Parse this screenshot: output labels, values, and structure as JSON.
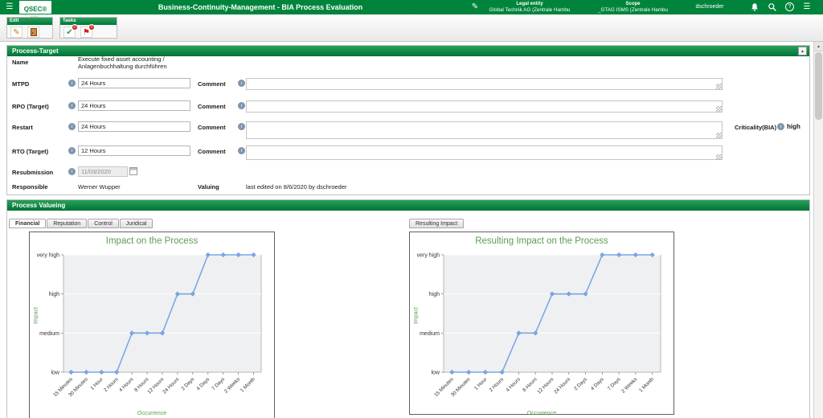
{
  "colors": {
    "topbar_green": "#00843c",
    "header_grad_top": "#2ca05a",
    "header_grad_bottom": "#00783a",
    "title_green": "#5b9e52",
    "badge_red": "#d21414",
    "chart_line": "#7da7e8"
  },
  "icons": {
    "menu": "☰",
    "pencil": "✎",
    "check": "✔",
    "flag": "⚑",
    "collapse_up": "▲",
    "scroll_up": "▲",
    "question": "?",
    "info": "i"
  },
  "top_bar": {
    "logo_text": "QSEC®",
    "logo_sub": "GRC",
    "title": "Business-Continuity-Management - BIA Process Evaluation",
    "legal_entity": {
      "label": "Legal entity",
      "value": "Global Technik AG (Zentrale Hambu"
    },
    "scope": {
      "label": "Scope",
      "value": "_GTAG ISMS (Zentrale Hambu"
    },
    "user": "dschroeder"
  },
  "toolbar": {
    "edit": {
      "label": "Edit"
    },
    "tasks": {
      "label": "Tasks",
      "badge1": "0",
      "badge2": "0"
    }
  },
  "process_target": {
    "title": "Process-Target",
    "comment_label": "Comment",
    "name": {
      "label": "Name",
      "line1": "Execute fixed asset accounting /",
      "line2": "Anlagenbuchhaltung durchführen"
    },
    "mtpd": {
      "label": "MTPD",
      "value": "24 Hours"
    },
    "rpo": {
      "label": "RPO (Target)",
      "value": "24 Hours"
    },
    "restart": {
      "label": "Restart",
      "value": "24 Hours"
    },
    "rto": {
      "label": "RTO (Target)",
      "value": "12 Hours"
    },
    "criticality": {
      "label": "Criticality(BIA)",
      "value": "high"
    },
    "resubmission": {
      "label": "Resubmission",
      "value": "11/03/2020"
    },
    "responsible": {
      "label": "Responsible",
      "value": "Werner Wupper"
    },
    "valuing": {
      "label": "Valuing",
      "value": "last edited on 8/6/2020 by dschroeder"
    }
  },
  "process_valueing": {
    "title": "Process Valueing",
    "tabs": [
      "Financial",
      "Reputation",
      "Control",
      "Juridical"
    ],
    "right_tab": "Resulting Impact"
  },
  "chart_data": [
    {
      "type": "line",
      "title": "Impact on the Process",
      "xlabel": "Occurrence",
      "ylabel": "Impact",
      "categories": [
        "15 Minutes",
        "30 Minutes",
        "1 Hour",
        "2 Hours",
        "4 Hours",
        "8 Hours",
        "12 Hours",
        "24 Hours",
        "2 Days",
        "4 Days",
        "7 Days",
        "2 Weeks",
        "1 Month"
      ],
      "y_categories": [
        "low",
        "medium",
        "high",
        "very high"
      ],
      "values": [
        "low",
        "low",
        "low",
        "low",
        "medium",
        "medium",
        "medium",
        "high",
        "high",
        "very high",
        "very high",
        "very high",
        "very high"
      ],
      "line_color": "#7da7e8",
      "legend": "none",
      "grid": "horizontal"
    },
    {
      "type": "line",
      "title": "Resulting Impact on the Process",
      "xlabel": "Occurrence",
      "ylabel": "Impact",
      "categories": [
        "15 Minutes",
        "30 Minutes",
        "1 Hour",
        "2 Hours",
        "4 Hours",
        "8 Hours",
        "12 Hours",
        "24 Hours",
        "2 Days",
        "4 Days",
        "7 Days",
        "2 Weeks",
        "1 Month"
      ],
      "y_categories": [
        "low",
        "medium",
        "high",
        "very high"
      ],
      "values": [
        "low",
        "low",
        "low",
        "low",
        "medium",
        "medium",
        "high",
        "high",
        "high",
        "very high",
        "very high",
        "very high",
        "very high"
      ],
      "line_color": "#7da7e8",
      "legend": "none",
      "grid": "horizontal"
    }
  ]
}
